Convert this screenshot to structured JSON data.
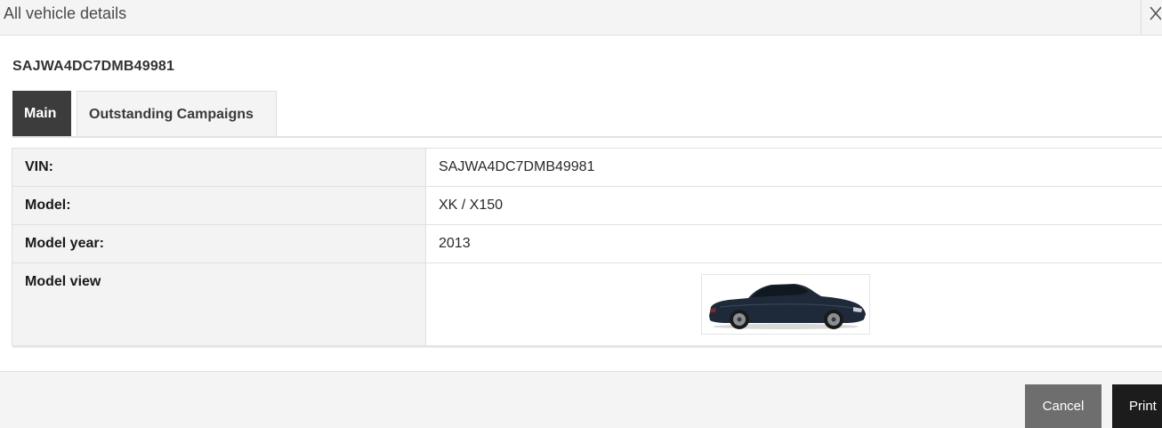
{
  "dialog": {
    "title": "All vehicle details"
  },
  "vehicle": {
    "heading": "SAJWA4DC7DMB49981"
  },
  "tabs": [
    {
      "label": "Main",
      "active": true
    },
    {
      "label": "Outstanding Campaigns",
      "active": false
    }
  ],
  "details": {
    "vin": {
      "label": "VIN:",
      "value": "SAJWA4DC7DMB49981"
    },
    "model": {
      "label": "Model:",
      "value": "XK / X150"
    },
    "model_year": {
      "label": "Model year:",
      "value": "2013"
    },
    "model_view": {
      "label": "Model view"
    }
  },
  "footer": {
    "cancel_label": "Cancel",
    "print_label": "Print"
  },
  "colors": {
    "active_tab": "#3c3c3c",
    "cancel_button": "#6e6e6e",
    "print_button": "#1c1c1c",
    "car_body": "#1e2a3a"
  },
  "icons": {
    "close": "close-icon"
  }
}
